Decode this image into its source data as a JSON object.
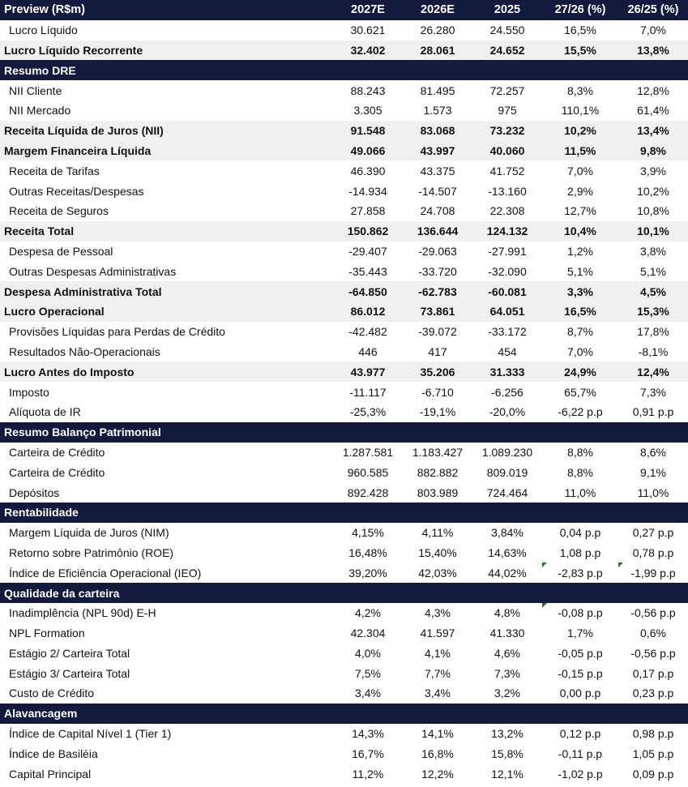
{
  "header": [
    "Preview (R$m)",
    "2027E",
    "2026E",
    "2025",
    "27/26 (%)",
    "26/25 (%)"
  ],
  "rows": [
    {
      "type": "normal",
      "cells": [
        "Lucro Líquido",
        "30.621",
        "26.280",
        "24.550",
        "16,5%",
        "7,0%"
      ]
    },
    {
      "type": "bold",
      "cells": [
        "Lucro Líquido Recorrente",
        "32.402",
        "28.061",
        "24.652",
        "15,5%",
        "13,8%"
      ]
    },
    {
      "type": "section",
      "cells": [
        "Resumo DRE",
        "",
        "",
        "",
        "",
        ""
      ]
    },
    {
      "type": "normal",
      "cells": [
        "NII Cliente",
        "88.243",
        "81.495",
        "72.257",
        "8,3%",
        "12,8%"
      ]
    },
    {
      "type": "normal",
      "cells": [
        "NII Mercado",
        "3.305",
        "1.573",
        "975",
        "110,1%",
        "61,4%"
      ]
    },
    {
      "type": "bold",
      "cells": [
        "Receita Líquida de Juros (NII)",
        "91.548",
        "83.068",
        "73.232",
        "10,2%",
        "13,4%"
      ]
    },
    {
      "type": "bold",
      "cells": [
        "Margem Financeira Líquida",
        "49.066",
        "43.997",
        "40.060",
        "11,5%",
        "9,8%"
      ]
    },
    {
      "type": "normal",
      "cells": [
        "Receita de Tarifas",
        "46.390",
        "43.375",
        "41.752",
        "7,0%",
        "3,9%"
      ]
    },
    {
      "type": "normal",
      "cells": [
        "Outras Receitas/Despesas",
        "-14.934",
        "-14.507",
        "-13.160",
        "2,9%",
        "10,2%"
      ]
    },
    {
      "type": "normal",
      "cells": [
        "Receita de Seguros",
        "27.858",
        "24.708",
        "22.308",
        "12,7%",
        "10,8%"
      ]
    },
    {
      "type": "bold",
      "cells": [
        "Receita Total",
        "150.862",
        "136.644",
        "124.132",
        "10,4%",
        "10,1%"
      ]
    },
    {
      "type": "normal",
      "cells": [
        "Despesa de Pessoal",
        "-29.407",
        "-29.063",
        "-27.991",
        "1,2%",
        "3,8%"
      ]
    },
    {
      "type": "normal",
      "cells": [
        "Outras Despesas Administrativas",
        "-35.443",
        "-33.720",
        "-32.090",
        "5,1%",
        "5,1%"
      ]
    },
    {
      "type": "bold",
      "cells": [
        "Despesa Administrativa Total",
        "-64.850",
        "-62.783",
        "-60.081",
        "3,3%",
        "4,5%"
      ]
    },
    {
      "type": "bold",
      "cells": [
        "Lucro Operacional",
        "86.012",
        "73.861",
        "64.051",
        "16,5%",
        "15,3%"
      ]
    },
    {
      "type": "normal",
      "cells": [
        "Provisões Líquidas para Perdas de Crédito",
        "-42.482",
        "-39.072",
        "-33.172",
        "8,7%",
        "17,8%"
      ]
    },
    {
      "type": "normal",
      "cells": [
        "Resultados Não-Operacionais",
        "446",
        "417",
        "454",
        "7,0%",
        "-8,1%"
      ]
    },
    {
      "type": "bold",
      "cells": [
        "Lucro Antes do Imposto",
        "43.977",
        "35.206",
        "31.333",
        "24,9%",
        "12,4%"
      ]
    },
    {
      "type": "normal",
      "cells": [
        "Imposto",
        "-11.117",
        "-6.710",
        "-6.256",
        "65,7%",
        "7,3%"
      ]
    },
    {
      "type": "normal",
      "cells": [
        "Alíquota de IR",
        "-25,3%",
        "-19,1%",
        "-20,0%",
        "-6,22 p.p",
        "0,91 p.p"
      ]
    },
    {
      "type": "section",
      "cells": [
        "Resumo Balanço Patrimonial",
        "",
        "",
        "",
        "",
        ""
      ]
    },
    {
      "type": "normal",
      "cells": [
        "Carteira de Crédito",
        "1.287.581",
        "1.183.427",
        "1.089.230",
        "8,8%",
        "8,6%"
      ]
    },
    {
      "type": "normal",
      "cells": [
        "Carteira de Crédito",
        "960.585",
        "882.882",
        "809.019",
        "8,8%",
        "9,1%"
      ]
    },
    {
      "type": "normal",
      "cells": [
        "Depósitos",
        "892.428",
        "803.989",
        "724.464",
        "11,0%",
        "11,0%"
      ]
    },
    {
      "type": "section",
      "cells": [
        "Rentabilidade",
        "",
        "",
        "",
        "",
        ""
      ]
    },
    {
      "type": "normal",
      "cells": [
        "Margem Líquida de Juros (NIM)",
        "4,15%",
        "4,11%",
        "3,84%",
        "0,04 p.p",
        "0,27 p.p"
      ]
    },
    {
      "type": "normal",
      "cells": [
        "Retorno sobre Patrimônio (ROE)",
        "16,48%",
        "15,40%",
        "14,63%",
        "1,08 p.p",
        "0,78 p.p"
      ]
    },
    {
      "type": "normal",
      "cells": [
        "Índice de Eficiência Operacional (IEO)",
        "39,20%",
        "42,03%",
        "44,02%",
        "-2,83 p.p",
        "-1,99 p.p"
      ]
    },
    {
      "type": "section",
      "cells": [
        "Qualidade da carteira",
        "",
        "",
        "",
        "",
        ""
      ]
    },
    {
      "type": "normal",
      "cells": [
        "Inadimplência (NPL 90d) E-H",
        "4,2%",
        "4,3%",
        "4,8%",
        "-0,08 p.p",
        "-0,56 p.p"
      ]
    },
    {
      "type": "normal",
      "cells": [
        "NPL Formation",
        "42.304",
        "41.597",
        "41.330",
        "1,7%",
        "0,6%"
      ]
    },
    {
      "type": "normal",
      "cells": [
        "Estágio 2/ Carteira Total",
        "4,0%",
        "4,1%",
        "4,6%",
        "-0,05 p.p",
        "-0,56 p.p"
      ]
    },
    {
      "type": "normal",
      "cells": [
        "Estágio 3/ Carteira Total",
        "7,5%",
        "7,7%",
        "7,3%",
        "-0,15 p.p",
        "0,17 p.p"
      ]
    },
    {
      "type": "normal",
      "cells": [
        "Custo de Crédito",
        "3,4%",
        "3,4%",
        "3,2%",
        "0,00 p.p",
        "0,23 p.p"
      ]
    },
    {
      "type": "section",
      "cells": [
        "Alavancagem",
        "",
        "",
        "",
        "",
        ""
      ]
    },
    {
      "type": "normal",
      "cells": [
        "Índice de Capital Nível 1 (Tier 1)",
        "14,3%",
        "14,1%",
        "13,2%",
        "0,12 p.p",
        "0,98 p.p"
      ]
    },
    {
      "type": "normal",
      "cells": [
        "Índice de Basiléia",
        "16,7%",
        "16,8%",
        "15,8%",
        "-0,11 p.p",
        "1,05 p.p"
      ]
    },
    {
      "type": "normal",
      "cells": [
        "Capital Principal",
        "11,2%",
        "12,2%",
        "12,1%",
        "-1,02 p.p",
        "0,09 p.p"
      ]
    }
  ],
  "colors": {
    "header_bg": "#131a3e",
    "bold_row_bg": "#f0f0f0",
    "marker": "#1f7a1f"
  }
}
